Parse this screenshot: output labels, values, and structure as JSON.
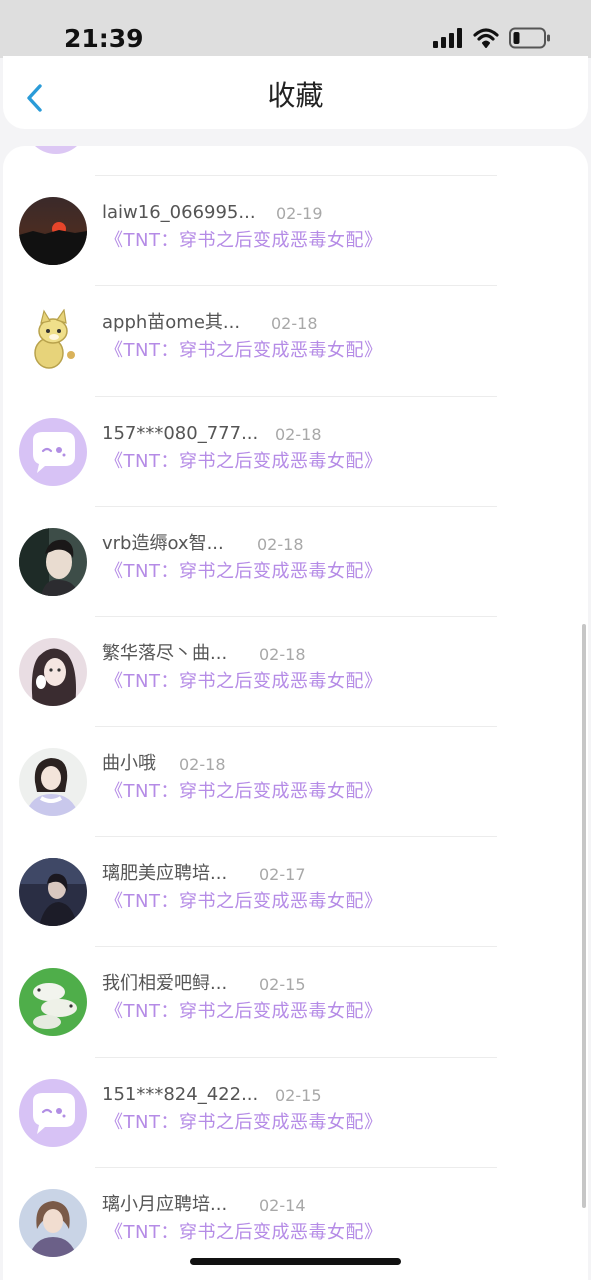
{
  "status_bar": {
    "time": "21:39",
    "icons": [
      "signal-icon",
      "wifi-icon",
      "battery-icon"
    ]
  },
  "nav": {
    "back_icon": "chevron-left-icon",
    "title": "收藏"
  },
  "colors": {
    "accent": "#2a9bd8",
    "novel_link": "#b58be6",
    "name_text": "#555555",
    "date_text": "#a8a8a8"
  },
  "items": [
    {
      "name": "laiw16_066995...",
      "date": "02-19",
      "novel": "《TNT：穿书之后变成恶毒女配》",
      "avatar": "sunset-avatar"
    },
    {
      "name": "apph苗ome其...",
      "date": "02-18",
      "novel": "《TNT：穿书之后变成恶毒女配》",
      "avatar": "dog-avatar"
    },
    {
      "name": "157***080_777...",
      "date": "02-18",
      "novel": "《TNT：穿书之后变成恶毒女配》",
      "avatar": "default-chat-avatar"
    },
    {
      "name": "vrb造缛ox智...",
      "date": "02-18",
      "novel": "《TNT：穿书之后变成恶毒女配》",
      "avatar": "boy-avatar"
    },
    {
      "name": "繁华落尽丶曲...",
      "date": "02-18",
      "novel": "《TNT：穿书之后变成恶毒女配》",
      "avatar": "girl-drawing-avatar"
    },
    {
      "name": "曲小哦",
      "date": "02-18",
      "novel": "《TNT：穿书之后变成恶毒女配》",
      "avatar": "girl-photo-avatar"
    },
    {
      "name": "璃肥美应聘培...",
      "date": "02-17",
      "novel": "《TNT：穿书之后变成恶毒女配》",
      "avatar": "dark-girl-avatar"
    },
    {
      "name": "我们相爱吧鲟...",
      "date": "02-15",
      "novel": "《TNT：穿书之后变成恶毒女配》",
      "avatar": "birds-avatar"
    },
    {
      "name": "151***824_422...",
      "date": "02-15",
      "novel": "《TNT：穿书之后变成恶毒女配》",
      "avatar": "default-chat-avatar"
    },
    {
      "name": "璃小月应聘培...",
      "date": "02-14",
      "novel": "《TNT：穿书之后变成恶毒女配》",
      "avatar": "portrait-girl-avatar"
    }
  ]
}
